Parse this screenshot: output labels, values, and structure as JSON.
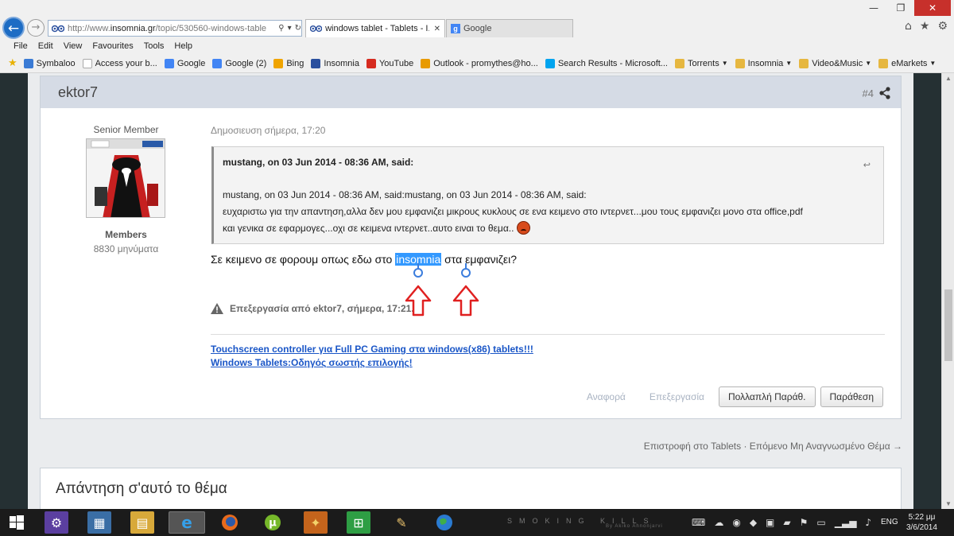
{
  "browser": {
    "url_prefix": "http://www.",
    "url_host": "insomnia.gr",
    "url_path": "/topic/530560-windows-table",
    "tabs": [
      {
        "title": "windows tablet - Tablets - I...",
        "active": true
      },
      {
        "title": "Google",
        "active": false
      }
    ],
    "menu": [
      "File",
      "Edit",
      "View",
      "Favourites",
      "Tools",
      "Help"
    ],
    "favourites": [
      {
        "label": "Symbaloo",
        "icon": "symbaloo-icon",
        "color": "#3a7bd5"
      },
      {
        "label": "Access your b...",
        "icon": "blank-icon",
        "color": ""
      },
      {
        "label": "Google",
        "icon": "google-icon",
        "color": "#4285f4"
      },
      {
        "label": "Google (2)",
        "icon": "google-icon",
        "color": "#4285f4"
      },
      {
        "label": "Bing",
        "icon": "bing-icon",
        "color": "#f0a400"
      },
      {
        "label": "Insomnia",
        "icon": "insomnia-icon",
        "color": "#2a4f9e"
      },
      {
        "label": "YouTube",
        "icon": "youtube-icon",
        "color": "#d62b1f"
      },
      {
        "label": "Outlook - promythes@ho...",
        "icon": "outlook-icon",
        "color": "#e89a00"
      },
      {
        "label": "Search Results - Microsoft...",
        "icon": "microsoft-icon",
        "color": "#00a4ef"
      },
      {
        "label": "Torrents",
        "icon": "folder-icon",
        "color": "#e6b740",
        "dropdown": true
      },
      {
        "label": "Insomnia",
        "icon": "folder-icon",
        "color": "#e6b740",
        "dropdown": true
      },
      {
        "label": "Video&Music",
        "icon": "folder-icon",
        "color": "#e6b740",
        "dropdown": true
      },
      {
        "label": "eMarkets",
        "icon": "folder-icon",
        "color": "#e6b740",
        "dropdown": true
      }
    ]
  },
  "post": {
    "author": "ektor7",
    "number": "#4",
    "member_title": "Senior Member",
    "group": "Members",
    "post_count": "8830 μηνύματα",
    "date": "Δημοσιευση σήμερα, 17:20",
    "quote": {
      "header": "mustang, on 03 Jun 2014 - 08:36 AM, said:",
      "lines": [
        "mustang, on 03 Jun 2014 - 08:36 AM, said:mustang, on 03 Jun 2014 - 08:36 AM, said:",
        "ευχαριστω για την απαντηση,αλλα δεν μου εμφανιζει μικρους κυκλους σε ενα κειμενο στο ιντερνετ...μου τους εμφανιζει μονο στα office,pdf",
        "και γενικα σε εφαρμογες...οχι σε κειμενα ιντερνετ..αυτο ειναι το θεμα.."
      ]
    },
    "text_before": "Σε κειμενο σε φορουμ  οπως εδω στο ",
    "text_selected": "insomnia",
    "text_after": " στα εμφανιζει?",
    "edit_note": "Επεξεργασία από ektor7, σήμερα, 17:21.",
    "signature_links": [
      "Touchscreen controller για Full PC Gaming στα windows(x86) tablets!!!",
      "Windows Tablets:Οδηγός σωστής επιλογής!"
    ],
    "actions": {
      "report": "Αναφορά",
      "edit": "Επεξεργασία",
      "multiquote": "Πολλαπλή Παράθ.",
      "quote": "Παράθεση"
    }
  },
  "topic_nav": "Επιστροφή στο Tablets · Επόμενο Μη Αναγνωσμένο Θέμα →",
  "reply_title": "Απάντηση σ'αυτό το θέμα",
  "taskbar": {
    "wallpaper_text": "SMOKING KILLS",
    "wallpaper_credit": "By Akiko Ahnonjarvi",
    "language": "ENG",
    "time": "5:22 μμ",
    "date": "3/6/2014"
  },
  "colors": {
    "selection": "#3399ff",
    "link": "#1a56c7",
    "annotation_arrow": "#e02020",
    "close_button": "#c7302b"
  }
}
